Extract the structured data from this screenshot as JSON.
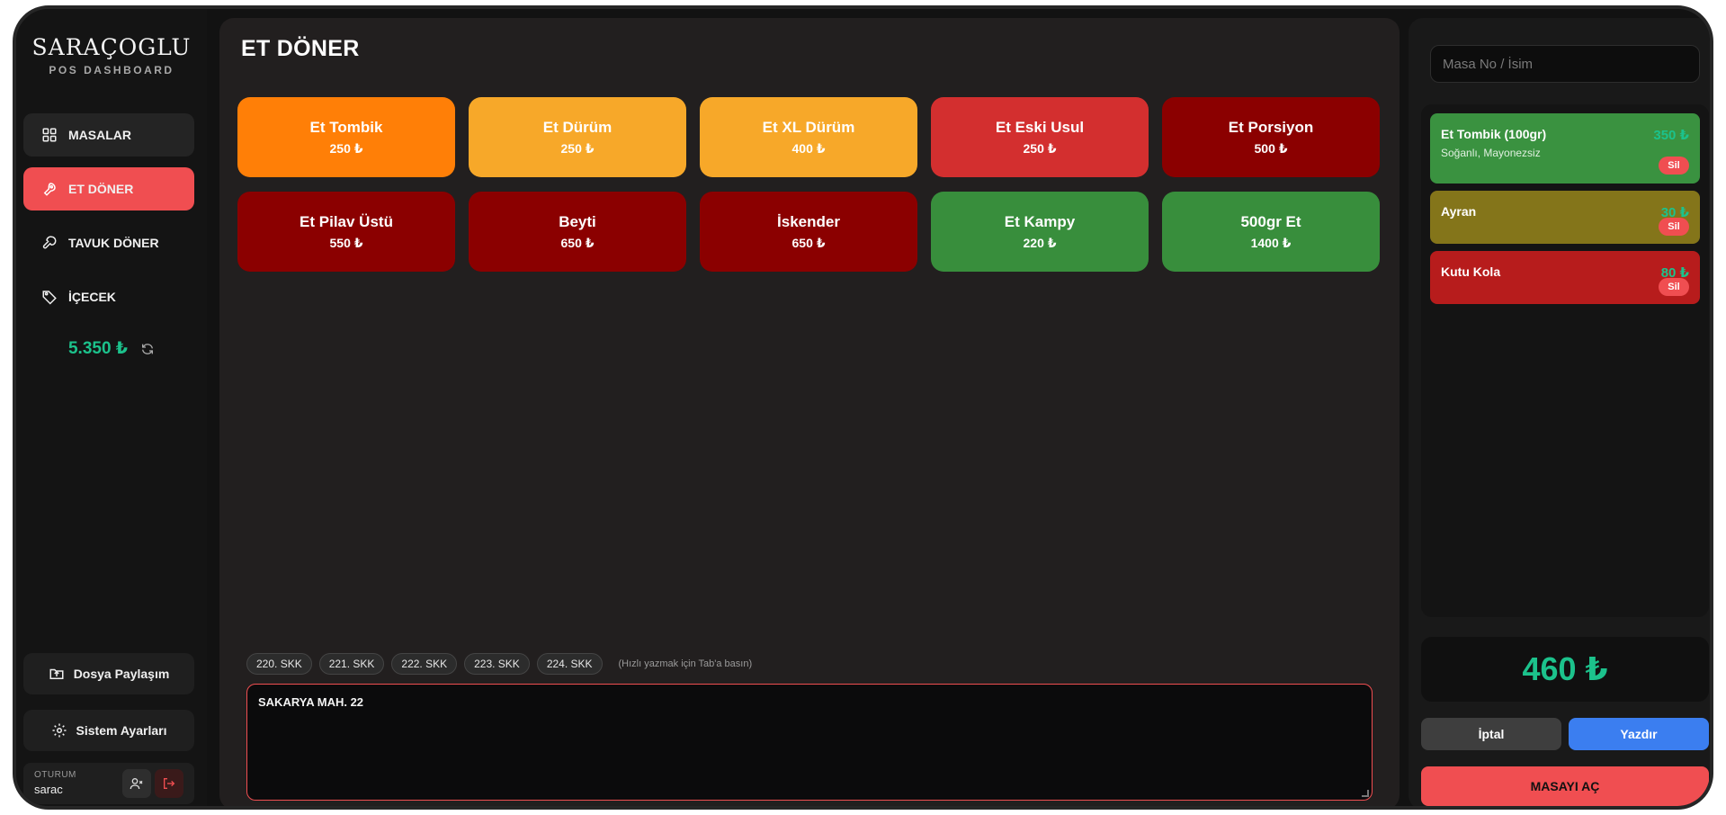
{
  "brand": {
    "name": "SARAÇOGLU",
    "subtitle": "POS DASHBOARD"
  },
  "nav": [
    {
      "label": "MASALAR",
      "icon": "grid-icon",
      "state": "hover"
    },
    {
      "label": "ET DÖNER",
      "icon": "meat-icon",
      "state": "active"
    },
    {
      "label": "TAVUK DÖNER",
      "icon": "drumstick-icon",
      "state": "normal"
    },
    {
      "label": "İÇECEK",
      "icon": "tag-icon",
      "state": "normal"
    }
  ],
  "daily_total": "5.350 ₺",
  "sidebar_buttons": {
    "file_share": "Dosya Paylaşım",
    "settings": "Sistem Ayarları"
  },
  "session": {
    "label": "OTURUM",
    "user": "sarac"
  },
  "page_title": "ET DÖNER",
  "products": [
    {
      "name": "Et Tombik",
      "price": "250 ₺",
      "color": "#ff7f07"
    },
    {
      "name": "Et Dürüm",
      "price": "250 ₺",
      "color": "#f7a829"
    },
    {
      "name": "Et XL Dürüm",
      "price": "400 ₺",
      "color": "#f7a829"
    },
    {
      "name": "Et Eski Usul",
      "price": "250 ₺",
      "color": "#d32f2f"
    },
    {
      "name": "Et Porsiyon",
      "price": "500 ₺",
      "color": "#8b0000"
    },
    {
      "name": "Et Pilav Üstü",
      "price": "550 ₺",
      "color": "#8b0000"
    },
    {
      "name": "Beyti",
      "price": "650 ₺",
      "color": "#8b0000"
    },
    {
      "name": "İskender",
      "price": "650 ₺",
      "color": "#8b0000"
    },
    {
      "name": "Et Kampy",
      "price": "220 ₺",
      "color": "#388e3c"
    },
    {
      "name": "500gr Et",
      "price": "1400 ₺",
      "color": "#388e3c"
    }
  ],
  "street_chips": [
    "220. SKK",
    "221. SKK",
    "222. SKK",
    "223. SKK",
    "224. SKK"
  ],
  "chip_hint": "(Hızlı yazmak için Tab'a basın)",
  "address_value": "SAKARYA MAH. 22",
  "search_placeholder": "Masa No / İsim",
  "order_items": [
    {
      "name": "Et Tombik (100gr)",
      "note": "Soğanlı, Mayonezsiz",
      "price": "350 ₺",
      "color": "#3a9240"
    },
    {
      "name": "Ayran",
      "note": "",
      "price": "30 ₺",
      "color": "#84751a"
    },
    {
      "name": "Kutu Kola",
      "note": "",
      "price": "80 ₺",
      "color": "#b71c1c"
    }
  ],
  "delete_label": "Sil",
  "order_total": "460 ₺",
  "actions": {
    "cancel": "İptal",
    "print": "Yazdır",
    "open_table": "MASAYI AÇ"
  }
}
